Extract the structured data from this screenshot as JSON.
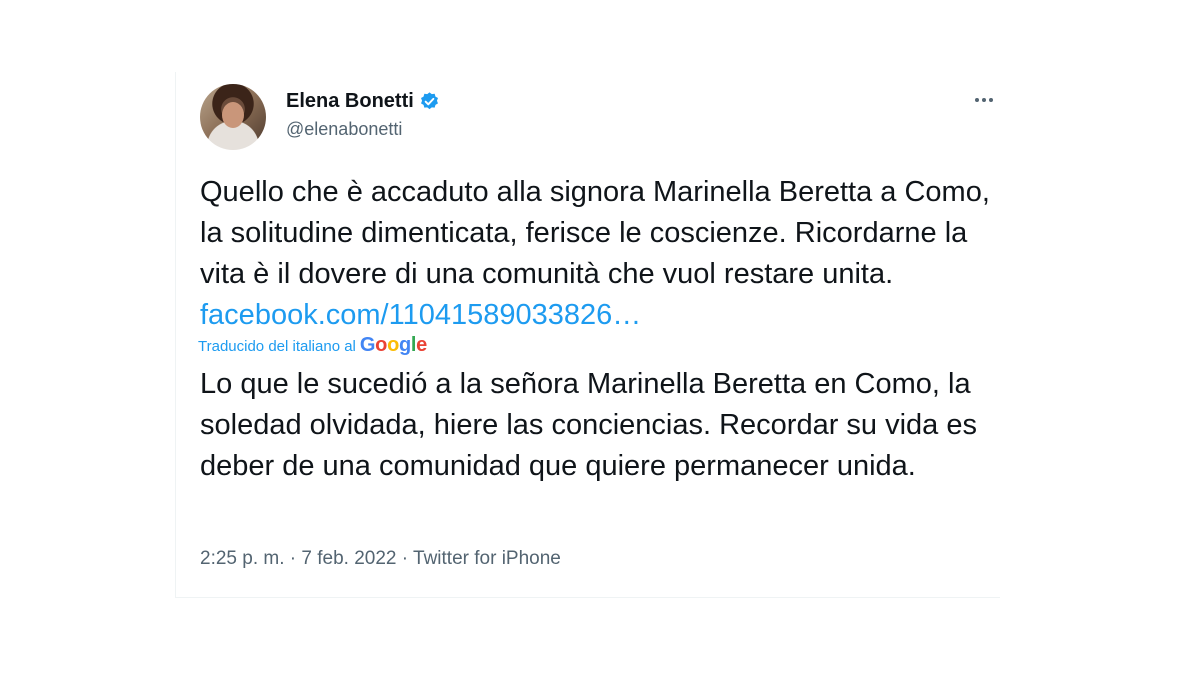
{
  "author": {
    "display_name": "Elena Bonetti",
    "handle": "@elenabonetti"
  },
  "tweet": {
    "text": "Quello che è accaduto alla signora Marinella Beretta a Como, la solitudine dimenticata, ferisce le coscienze. Ricordarne la vita è il dovere di una comunità che vuol restare unita.",
    "link_text": "facebook.com/11041589033826…",
    "translated_by_label": "Traducido del italiano al",
    "translation_provider": "Google",
    "translation": "Lo que le sucedió a la señora Marinella Beretta en Como, la soledad olvidada, hiere las conciencias. Recordar su vida es deber de una comunidad que quiere permanecer unida.",
    "time": "2:25 p. m.",
    "separator": "·",
    "date": "7 feb. 2022",
    "source": "Twitter for iPhone"
  },
  "icons": {
    "verified": "verified-badge-icon",
    "more": "more-options-icon"
  },
  "colors": {
    "link": "#1d9bf0",
    "secondary_text": "#536471",
    "primary_text": "#0f1419",
    "verified": "#1d9bf0"
  }
}
